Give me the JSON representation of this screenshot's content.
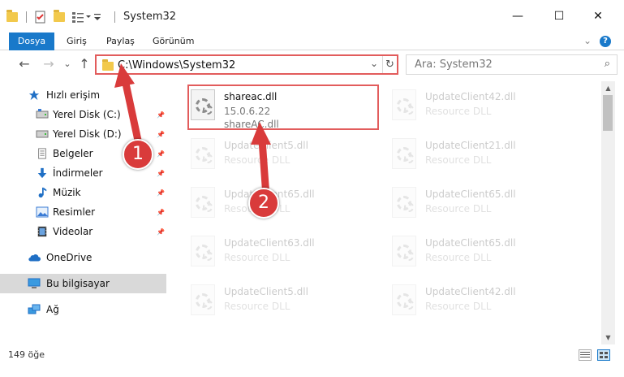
{
  "window": {
    "title": "System32",
    "minimize_glyph": "—",
    "maximize_glyph": "☐",
    "close_glyph": "✕"
  },
  "ribbon": {
    "tabs": [
      "Dosya",
      "Giriş",
      "Paylaş",
      "Görünüm"
    ],
    "expand_glyph": "⌄",
    "help_glyph": "?",
    "accent_color": "#1979ca"
  },
  "navigation": {
    "back_glyph": "←",
    "forward_glyph": "→",
    "recent_glyph": "⌄",
    "up_glyph": "↑",
    "address": "C:\\Windows\\System32",
    "dropdown_glyph": "⌄",
    "refresh_glyph": "↻",
    "search_placeholder": "Ara: System32",
    "search_glyph": "⌕"
  },
  "sidebar": {
    "items": [
      {
        "label": "Hızlı erişim",
        "icon": "star-icon",
        "pinned": false
      },
      {
        "label": "Yerel Disk (C:)",
        "icon": "drive-icon",
        "pinned": true
      },
      {
        "label": "Yerel Disk (D:)",
        "icon": "drive-icon",
        "pinned": true
      },
      {
        "label": "Belgeler",
        "icon": "documents-icon",
        "pinned": true
      },
      {
        "label": "İndirmeler",
        "icon": "downloads-icon",
        "pinned": true
      },
      {
        "label": "Müzik",
        "icon": "music-icon",
        "pinned": true
      },
      {
        "label": "Resimler",
        "icon": "pictures-icon",
        "pinned": true
      },
      {
        "label": "Videolar",
        "icon": "videos-icon",
        "pinned": true
      },
      {
        "label": "OneDrive",
        "icon": "cloud-icon",
        "pinned": false
      },
      {
        "label": "Bu bilgisayar",
        "icon": "computer-icon",
        "pinned": false,
        "selected": true
      },
      {
        "label": "Ağ",
        "icon": "network-icon",
        "pinned": false
      }
    ],
    "pin_glyph": "📌"
  },
  "files": [
    {
      "name": "shareac.dll",
      "line2": "15.0.6.22",
      "line3": "shareAC.dll",
      "highlighted": true
    },
    {
      "name": "UpdateClient42.dll",
      "line2": "Resource DLL"
    },
    {
      "name": "UpdateClient5.dll",
      "line2": "Resource DLL"
    },
    {
      "name": "UpdateClient21.dll",
      "line2": "Resource DLL"
    },
    {
      "name": "UpdateClient65.dll",
      "line2": "Resource DLL"
    },
    {
      "name": "UpdateClient65.dll",
      "line2": "Resource DLL"
    },
    {
      "name": "UpdateClient63.dll",
      "line2": "Resource DLL"
    },
    {
      "name": "UpdateClient65.dll",
      "line2": "Resource DLL"
    },
    {
      "name": "UpdateClient5.dll",
      "line2": "Resource DLL"
    },
    {
      "name": "UpdateClient42.dll",
      "line2": "Resource DLL"
    }
  ],
  "scrollbar": {
    "up_glyph": "▲",
    "down_glyph": "▼"
  },
  "status": {
    "item_count": "149 öğe"
  },
  "annotations": {
    "step1": "1",
    "step2": "2",
    "color": "#d93b3b"
  }
}
